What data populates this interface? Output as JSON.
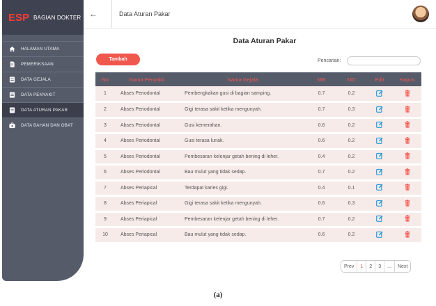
{
  "brand": {
    "logo": "ESP",
    "name": "BAGIAN DOKTER"
  },
  "sidebar": {
    "items": [
      {
        "label": "HALAMAN UTAMA",
        "icon": "home-icon",
        "active": false
      },
      {
        "label": "PEMERIKSAAN",
        "icon": "document-icon",
        "active": false
      },
      {
        "label": "DATA GEJALA",
        "icon": "list-icon",
        "active": false
      },
      {
        "label": "DATA PENYAKIT",
        "icon": "list-icon",
        "active": false
      },
      {
        "label": "DATA ATURAN PAKAR",
        "icon": "list-icon",
        "active": true
      },
      {
        "label": "DATA BAHAN DAN OBAT",
        "icon": "briefcase-icon",
        "active": false
      }
    ]
  },
  "header": {
    "title": "Data Aturan Pakar"
  },
  "main": {
    "title": "Data Aturan Pakar",
    "add_label": "Tambah",
    "search_label": "Pencarian:",
    "search_value": "",
    "columns": [
      "No",
      "Nama Penyakit",
      "Nama Gejala",
      "MB",
      "MD",
      "Edit",
      "Hapus"
    ],
    "rows": [
      {
        "no": "1",
        "penyakit": "Abses Periodontal",
        "gejala": "Pembengkakan gusi di bagian samping.",
        "mb": "0.7",
        "md": "0.2"
      },
      {
        "no": "2",
        "penyakit": "Abses Periodontal",
        "gejala": "Gigi terasa sakit ketika mengunyah.",
        "mb": "0.7",
        "md": "0.3"
      },
      {
        "no": "3",
        "penyakit": "Abses Periodontal",
        "gejala": "Gusi kemerahan.",
        "mb": "0.6",
        "md": "0.2"
      },
      {
        "no": "4",
        "penyakit": "Abses Periodontal",
        "gejala": "Gusi terasa lunak.",
        "mb": "0.6",
        "md": "0.2"
      },
      {
        "no": "5",
        "penyakit": "Abses Periodontal",
        "gejala": "Pembesaran kelenjar getah bening di leher.",
        "mb": "0.4",
        "md": "0.2"
      },
      {
        "no": "6",
        "penyakit": "Abses Periodontal",
        "gejala": "Bau mulut yang tidak sedap.",
        "mb": "0.7",
        "md": "0.2"
      },
      {
        "no": "7",
        "penyakit": "Abses Periapical",
        "gejala": "Terdapat karies gigi.",
        "mb": "0.4",
        "md": "0.1"
      },
      {
        "no": "8",
        "penyakit": "Abses Periapical",
        "gejala": "Gigi terasa sakit ketika mengunyah.",
        "mb": "0.6",
        "md": "0.3"
      },
      {
        "no": "9",
        "penyakit": "Abses Periapical",
        "gejala": "Pembesaran kelenjar getah bening di leher.",
        "mb": "0.7",
        "md": "0.2"
      },
      {
        "no": "10",
        "penyakit": "Abses Periapical",
        "gejala": "Bau mulut yang tidak sedap.",
        "mb": "0.6",
        "md": "0.2"
      }
    ],
    "edit_icon": "edit-icon",
    "delete_icon": "trash-icon"
  },
  "pagination": {
    "prev": "Prev",
    "pages": [
      "1",
      "2",
      "3"
    ],
    "current": "1",
    "ellipsis": "...",
    "next": "Next"
  },
  "caption": "(a)",
  "colors": {
    "accent": "#f0574d",
    "sidebar": "#565b6a",
    "row": "#f7ebe9",
    "edit": "#2a9bd8",
    "delete": "#f0574d"
  }
}
